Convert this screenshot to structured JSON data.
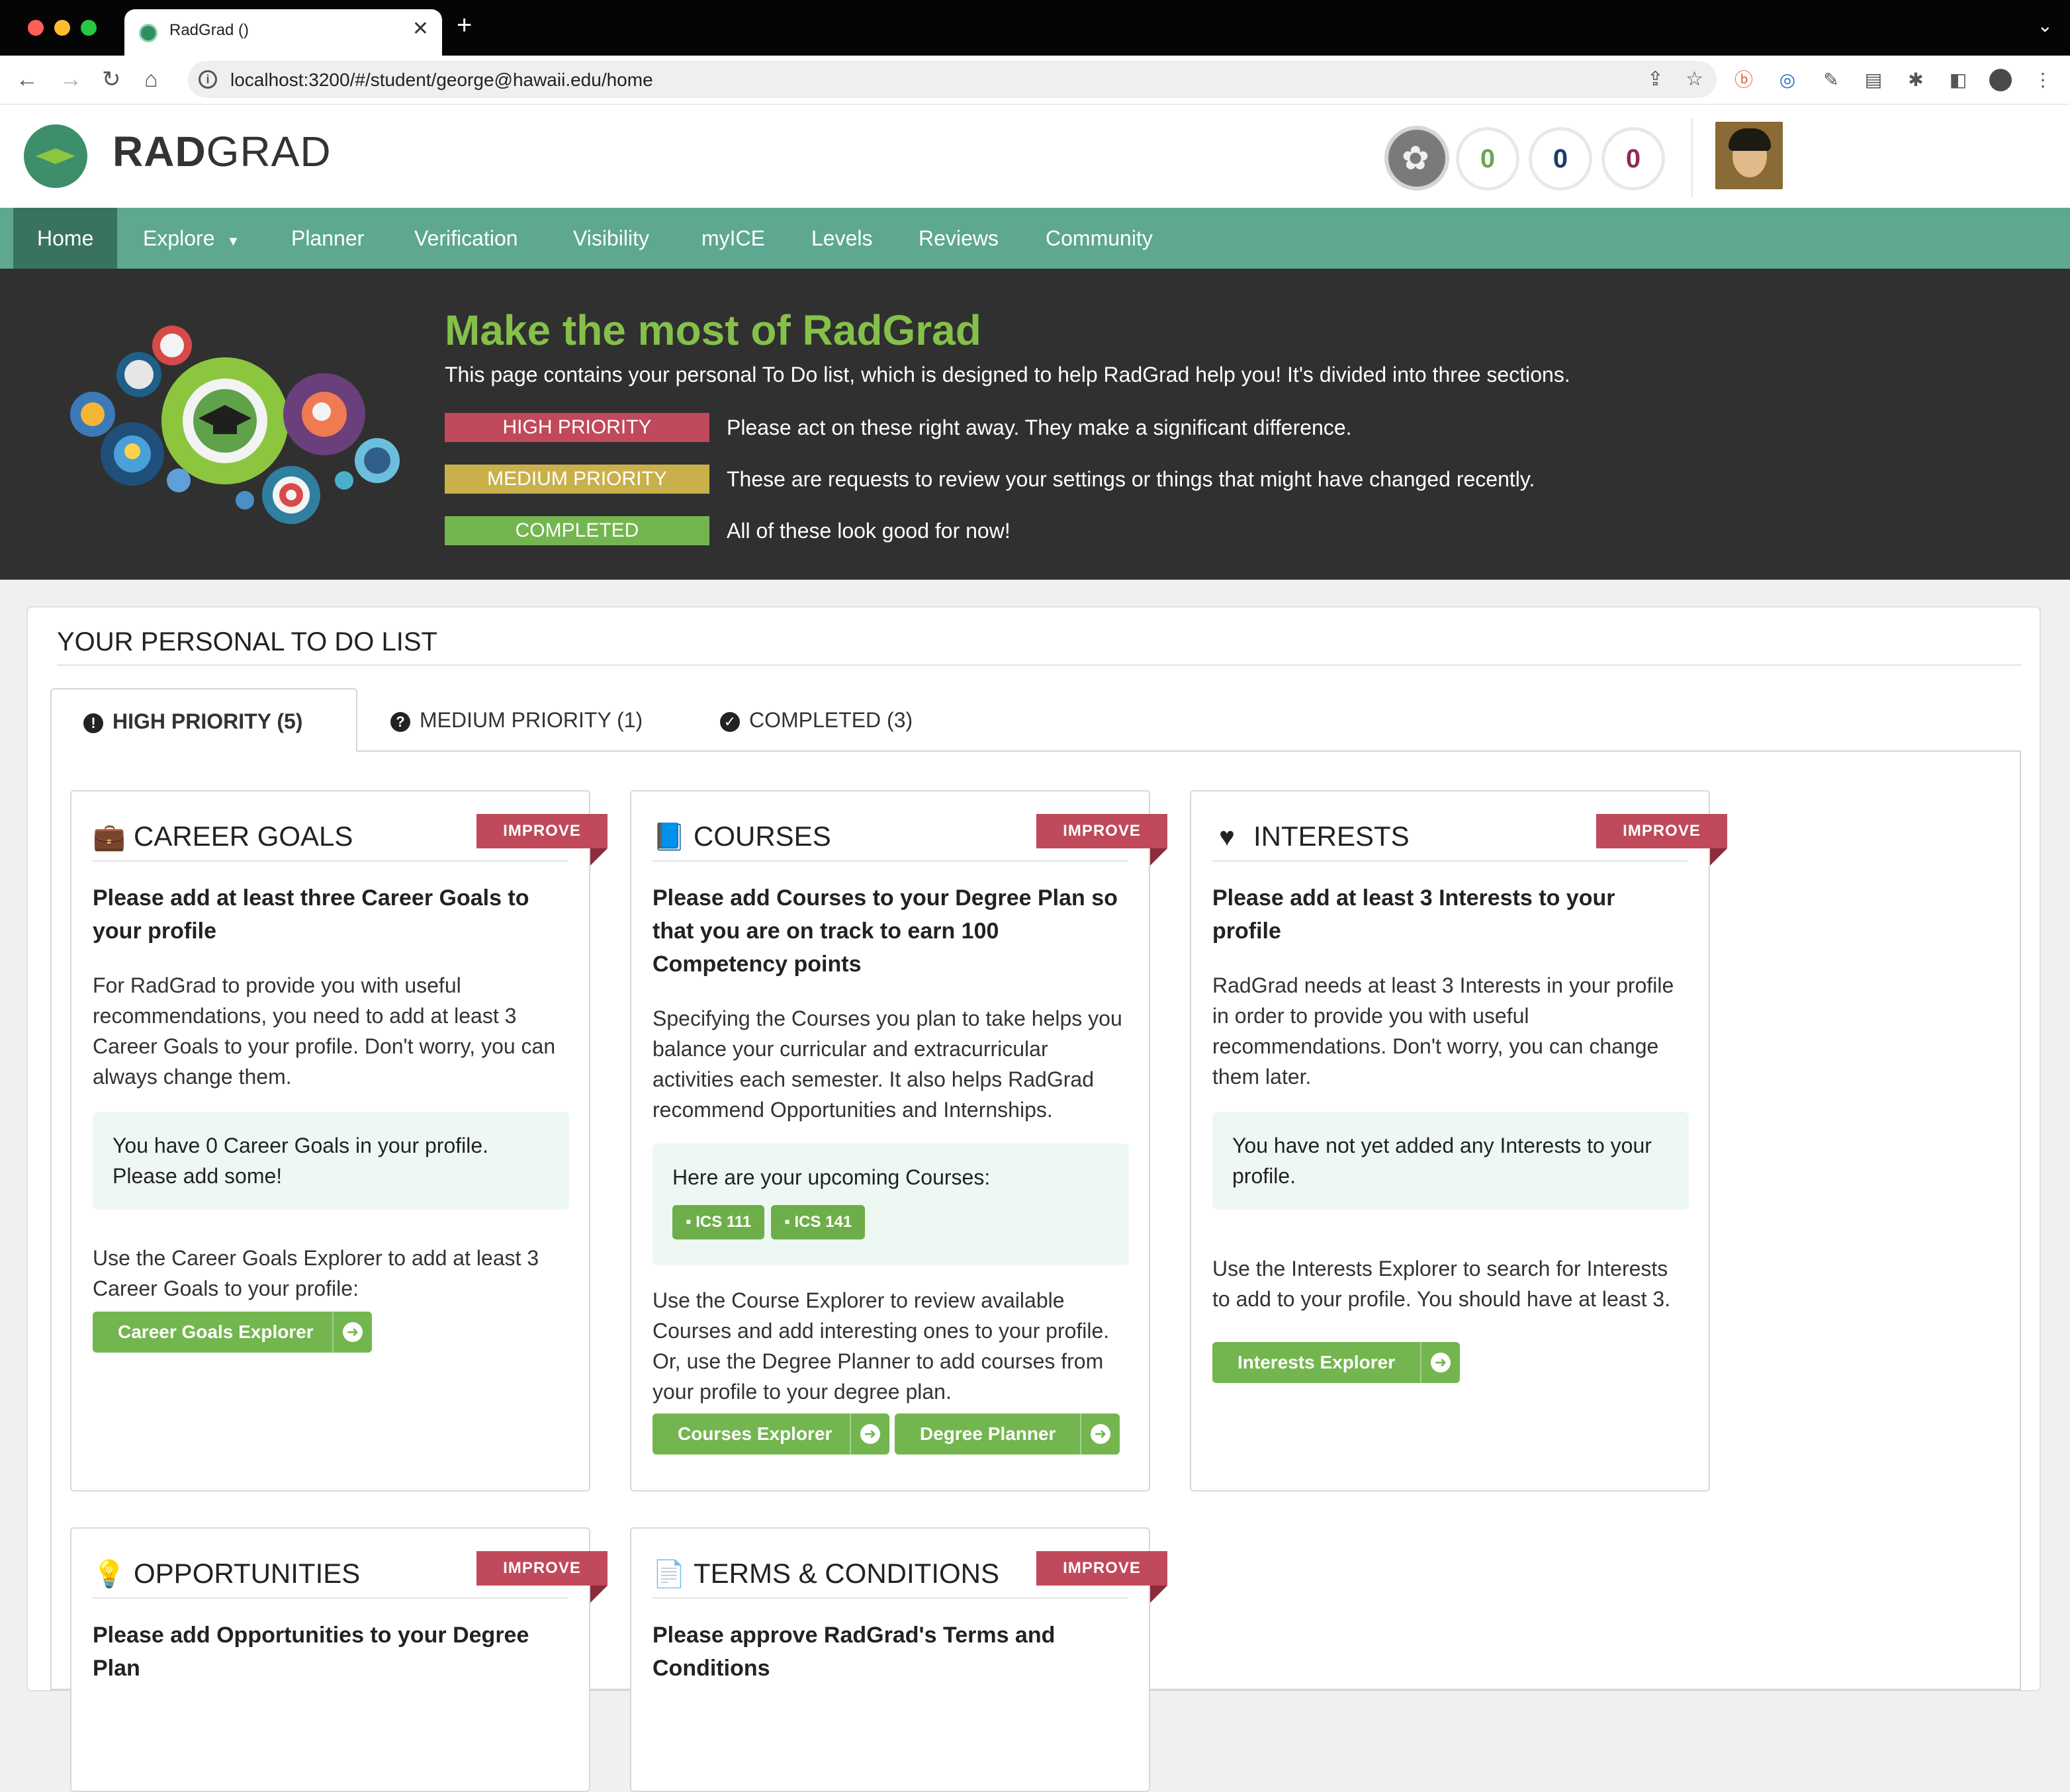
{
  "browser": {
    "tab_title": "RadGrad ()",
    "url": "localhost:3200/#/student/george@hawaii.edu/home"
  },
  "header": {
    "brand_bold": "RAD",
    "brand_light": "GRAD",
    "scores": [
      {
        "value": "0",
        "color": "#6aa84f"
      },
      {
        "value": "0",
        "color": "#1c3a6e"
      },
      {
        "value": "0",
        "color": "#8e2c5c"
      }
    ]
  },
  "menu": {
    "items": [
      {
        "label": "Home"
      },
      {
        "label": "Explore"
      },
      {
        "label": "Planner"
      },
      {
        "label": "Verification"
      },
      {
        "label": "Visibility"
      },
      {
        "label": "myICE"
      },
      {
        "label": "Levels"
      },
      {
        "label": "Reviews"
      },
      {
        "label": "Community"
      }
    ]
  },
  "banner": {
    "title": "Make the most of RadGrad",
    "description": "This page contains your personal To Do list, which is designed to help RadGrad help you! It's divided into three sections.",
    "priorities": [
      {
        "label": "HIGH PRIORITY",
        "text": "Please act on these right away. They make a significant difference.",
        "color": "#c0495b"
      },
      {
        "label": "MEDIUM PRIORITY",
        "text": "These are requests to review your settings or things that might have changed recently.",
        "color": "#c9b04a"
      },
      {
        "label": "COMPLETED",
        "text": "All of these look good for now!",
        "color": "#73b64f"
      }
    ]
  },
  "todo": {
    "title": "YOUR PERSONAL TO DO LIST",
    "tabs": [
      {
        "label": "HIGH PRIORITY (5)",
        "icon": "exclamation-circle-icon"
      },
      {
        "label": "MEDIUM PRIORITY (1)",
        "icon": "question-circle-icon"
      },
      {
        "label": "COMPLETED (3)",
        "icon": "check-circle-icon"
      }
    ],
    "ribbon_label": "IMPROVE",
    "cards": {
      "career": {
        "title": "CAREER GOALS",
        "subtitle": "Please add at least three Career Goals to your profile",
        "text": "For RadGrad to provide you with useful recommendations, you need to add at least 3 Career Goals to your profile. Don't worry, you can always change them.",
        "info": "You have 0 Career Goals in your profile. Please add some!",
        "footer": "Use the Career Goals Explorer to add at least 3 Career Goals to your profile:",
        "button": "Career Goals Explorer"
      },
      "courses": {
        "title": "COURSES",
        "subtitle": "Please add Courses to your Degree Plan so that you are on track to earn 100 Competency points",
        "text": "Specifying the Courses you plan to take helps you balance your curricular and extracurricular activities each semester. It also helps RadGrad recommend Opportunities and Internships.",
        "info": "Here are your upcoming Courses:",
        "chips": [
          "ICS 111",
          "ICS 141"
        ],
        "footer": "Use the Course Explorer to review available Courses and add interesting ones to your profile. Or, use the Degree Planner to add courses from your profile to your degree plan.",
        "button1": "Courses Explorer",
        "button2": "Degree Planner"
      },
      "interests": {
        "title": "INTERESTS",
        "subtitle": "Please add at least 3 Interests to your profile",
        "text": "RadGrad needs at least 3 Interests in your profile in order to provide you with useful recommendations. Don't worry, you can change them later.",
        "info": "You have not yet added any Interests to your profile.",
        "footer": "Use the Interests Explorer to search for Interests to add to your profile. You should have at least 3.",
        "button": "Interests Explorer"
      },
      "opportunities": {
        "title": "OPPORTUNITIES",
        "subtitle": "Please add Opportunities to your Degree Plan"
      },
      "terms": {
        "title": "TERMS & CONDITIONS",
        "subtitle": "Please approve RadGrad's Terms and Conditions"
      }
    }
  }
}
